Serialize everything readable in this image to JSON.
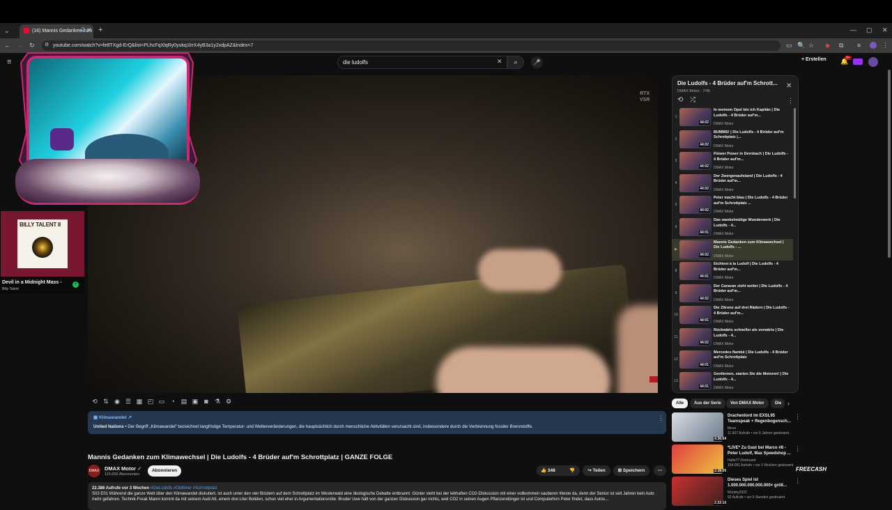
{
  "browser": {
    "tab_title": "(16) Mannis Gedanken zum",
    "url": "youtube.com/watch?v=fe8TXgd-ErQ&list=PLhcFqXlqRy0yukq1lrrX4yB3a1y2xdpAZ&index=7"
  },
  "header": {
    "search_value": "die ludolfs",
    "create_label": "Erstellen",
    "notif_count": "9+"
  },
  "video": {
    "badge": "RTX\nVSR"
  },
  "info_panel": {
    "title": "Klimawandel",
    "source": "United Nations",
    "text": " • Der Begriff „Klimawandel“ bezeichnet langfristige Temperatur- und Wetterveränderungen, die hauptsächlich durch menschliche Aktivitäten verursacht sind, insbesondere durch die Verbrennung fossiler Brennstoffe."
  },
  "main": {
    "title": "Mannis Gedanken zum Klimawechsel | Die Ludolfs - 4 Brüder auf'm Schrottplatz | GANZE FOLGE",
    "channel": "DMAX Motor",
    "subs": "115.000 Abonnenten",
    "subscribe": "Abonnieren",
    "likes": "348",
    "share": "Teilen",
    "save": "Speichern",
    "desc_meta": "22.386 Aufrufe  vor 3 Wochen",
    "desc_tags": "#DieLudolfs #Oldtimer #Schrottplatz",
    "desc_text": "S03 E01 Während die ganze Welt über den Klimawandel diskutiert, ist auch unter den vier Brüdern auf dem Schrottplatz im Westerwald eine ökologische Debatte entbrannt. Günter steht bei der lebhaften CO2-Diskussion mit einer vollkommen sauberen Weste da, denn der Senior ist seit Jahren kein Auto mehr gefahren. Technik-Freak Manni kommt da mit seinem Audi A6, einem drei Liter Boliden, schon viel eher in Argumentationsnöte. Bruder Uwe hält von der ganzen Diskussion gar nichts, weil CO2 in seinen Augen Pflanzendünger ist und Computerhirn Peter findet, dass Autos..."
  },
  "spotify": {
    "album_text": "BILLY TALENT II",
    "song": "Devil in a Midnight Mass -",
    "artist": "Billy Talent"
  },
  "playlist": {
    "title": "Die Ludolfs - 4 Brüder auf'm Schrott...",
    "sub": "DMAX Motor - 7/45",
    "items": [
      {
        "idx": "1",
        "title": "In meinem Opel bin ich Kapitän | Die Ludolfs - 4 Brüder auf'm...",
        "channel": "DMAX Motor",
        "dur": "44:02"
      },
      {
        "idx": "2",
        "title": "BUMMS! | Die Ludolfs - 4 Brüder auf'm Schrottplatz |...",
        "channel": "DMAX Motor",
        "dur": "44:02"
      },
      {
        "idx": "3",
        "title": "Flower Power in Dernbach | Die Ludolfs - 4 Brüder auf'm...",
        "channel": "DMAX Motor",
        "dur": "44:02"
      },
      {
        "idx": "4",
        "title": "Der Zwergenaufstand | Die Ludolfs - 4 Brüder auf'm...",
        "channel": "DMAX Motor",
        "dur": "44:02"
      },
      {
        "idx": "5",
        "title": "Peter macht blau | Die Ludolfs - 4 Brüder auf'm Schrottplatz ...",
        "channel": "DMAX Motor",
        "dur": "44:02"
      },
      {
        "idx": "6",
        "title": "Das wankelmütige Wunderwerk | Die Ludolfs - 4...",
        "channel": "DMAX Motor",
        "dur": "44:01"
      },
      {
        "idx": "▶",
        "title": "Mannis Gedanken zum Klimawechsel | Die Ludolfs - ...",
        "channel": "DMAX Motor",
        "dur": "44:02"
      },
      {
        "idx": "8",
        "title": "Eichtest à la Ludolf | Die Ludolfs - 4 Brüder auf'm...",
        "channel": "DMAX Motor",
        "dur": "44:01"
      },
      {
        "idx": "9",
        "title": "Der Caravan zieht weiter | Die Ludolfs - 4 Brüder auf'm...",
        "channel": "DMAX Motor",
        "dur": "44:02"
      },
      {
        "idx": "10",
        "title": "Die Zitrone auf drei Rädern | Die Ludolfs - 4 Brüder auf'm...",
        "channel": "DMAX Motor",
        "dur": "44:01"
      },
      {
        "idx": "11",
        "title": "Rückwärts schneller als vorwärts | Die Ludolfs - 4...",
        "channel": "DMAX Motor",
        "dur": "44:02"
      },
      {
        "idx": "12",
        "title": "Mercedes flambé | Die Ludolfs - 4 Brüder auf'm Schrottplatz",
        "channel": "DMAX Motor",
        "dur": "44:01"
      },
      {
        "idx": "13",
        "title": "Gentlemen, starten Sie die Motoren! | Die Ludolfs - 4...",
        "channel": "DMAX Motor",
        "dur": "44:01"
      }
    ]
  },
  "chips": [
    "Alle",
    "Aus der Serie",
    "Von DMAX Motor",
    "Die"
  ],
  "recs": [
    {
      "title": "Drachenlord im EXSL95 Teamspeak + Regenbogensch...",
      "channel": "Meso",
      "meta": "11.507 Aufrufe • vor 6 Jahren gestreamt",
      "dur": "4:36:54",
      "c1": "#d8dde4",
      "c2": "#6b7a8a"
    },
    {
      "title": "*LIVE* Zu Gast bei Marco #8 - Peter Ludolf, Max Speedshop ...",
      "channel": "Halle77 Dortmund",
      "meta": "164.091 Aufrufe • vor 2 Wochen gestreamt",
      "dur": "2:38:05",
      "c1": "#e04040",
      "c2": "#f0c040"
    },
    {
      "title": "Dieses Spiel ist 1.000.000.000.000.000× größ...",
      "channel": "Murphy2022",
      "meta": "92 Aufrufe • vor 9 Stunden gestreamt",
      "dur": "2:22:10",
      "c1": "#c83030",
      "c2": "#402020"
    }
  ],
  "overlay": {
    "freecash": "FREECASH"
  }
}
